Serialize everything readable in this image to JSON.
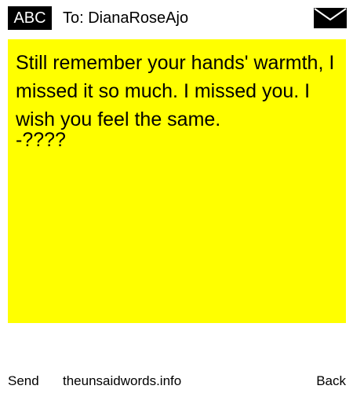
{
  "header": {
    "badge_label": "ABC",
    "recipient": "To: DianaRoseAjo",
    "envelope_icon": "envelope-icon"
  },
  "message": {
    "body": "Still remember your hands' warmth, I missed it so much. I missed you. I wish you feel the same.",
    "signature": "-????",
    "background_color": "#ffff00"
  },
  "footer": {
    "send_label": "Send",
    "site_label": "theunsaidwords.info",
    "back_label": "Back"
  }
}
